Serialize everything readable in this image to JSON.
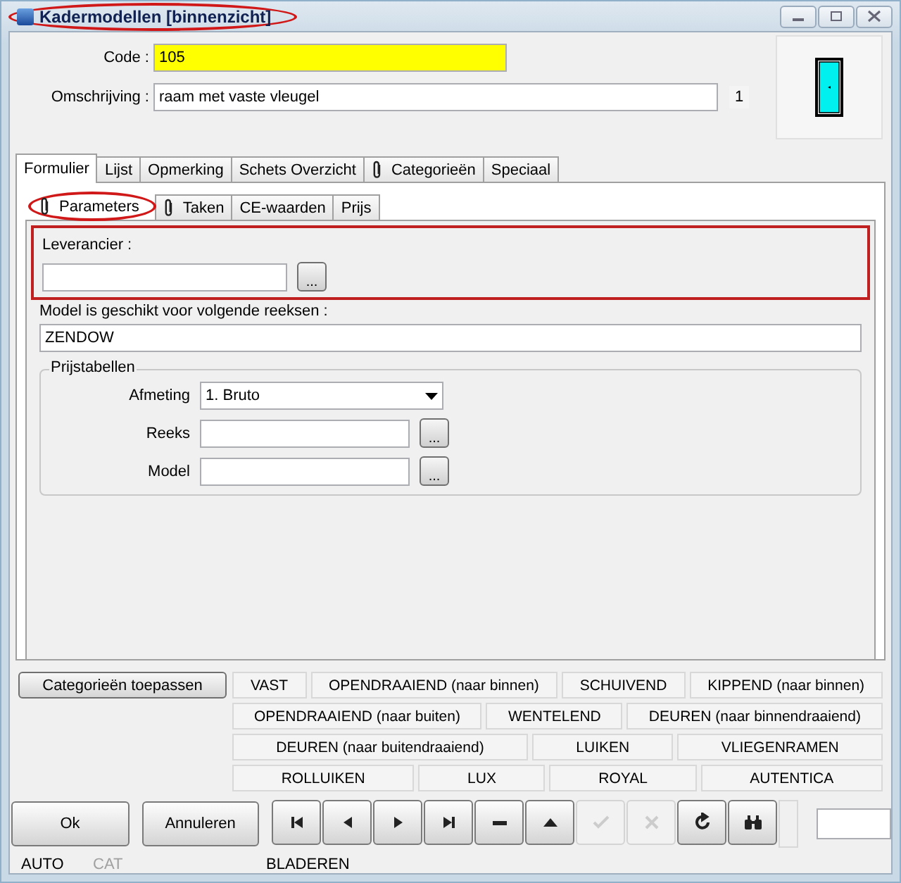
{
  "window": {
    "title": "Kadermodellen [binnenzicht]",
    "highlighted": true
  },
  "header": {
    "code_label": "Code :",
    "code": "105",
    "description_label": "Omschrijving :",
    "description": "raam met vaste vleugel",
    "description_count": "1"
  },
  "tabs": [
    {
      "label": "Formulier",
      "selected": true,
      "attachment": false
    },
    {
      "label": "Lijst",
      "selected": false,
      "attachment": false
    },
    {
      "label": "Opmerking",
      "selected": false,
      "attachment": false
    },
    {
      "label": "Schets Overzicht",
      "selected": false,
      "attachment": false
    },
    {
      "label": "Categorieën",
      "selected": false,
      "attachment": true
    },
    {
      "label": "Speciaal",
      "selected": false,
      "attachment": false
    }
  ],
  "subtabs": [
    {
      "label": "Parameters",
      "selected": true,
      "attachment": true,
      "highlighted": true
    },
    {
      "label": "Taken",
      "selected": false,
      "attachment": true,
      "highlighted": false
    },
    {
      "label": "CE-waarden",
      "selected": false,
      "attachment": false,
      "highlighted": false
    },
    {
      "label": "Prijs",
      "selected": false,
      "attachment": false,
      "highlighted": false
    }
  ],
  "supplier": {
    "label": "Leverancier :",
    "browse": "...",
    "highlighted": true
  },
  "series": {
    "label": "Model is geschikt voor volgende reeksen :",
    "value": "ZENDOW"
  },
  "price_tables": {
    "title": "Prijstabellen",
    "rows": [
      {
        "kind": "dropdown",
        "label": "Afmeting",
        "value": "1.  Bruto"
      },
      {
        "kind": "lookup",
        "label": "Reeks",
        "browse": "..."
      },
      {
        "kind": "lookup",
        "label": "Model",
        "browse": "..."
      }
    ]
  },
  "apply_button": "Categorieën toepassen",
  "category_rows": [
    [
      "VAST",
      "OPENDRAAIEND (naar binnen)",
      "SCHUIVEND",
      "KIPPEND (naar binnen)"
    ],
    [
      "OPENDRAAIEND (naar buiten)",
      "WENTELEND",
      "DEUREN (naar binnendraaiend)"
    ],
    [
      "DEUREN (naar buitendraaiend)",
      "LUIKEN",
      "VLIEGENRAMEN"
    ],
    [
      "ROLLUIKEN",
      "LUX",
      "ROYAL",
      "AUTENTICA"
    ]
  ],
  "footer": {
    "ok": "Ok",
    "cancel": "Annuleren",
    "tools": [
      {
        "kind": "first",
        "disabled": false
      },
      {
        "kind": "previous",
        "disabled": false
      },
      {
        "kind": "next",
        "disabled": false
      },
      {
        "kind": "last",
        "disabled": false
      },
      {
        "kind": "delete",
        "disabled": false
      },
      {
        "kind": "up",
        "disabled": false
      },
      {
        "kind": "confirm",
        "disabled": true
      },
      {
        "kind": "cancel",
        "disabled": true
      },
      {
        "kind": "refresh",
        "disabled": false
      },
      {
        "kind": "search",
        "disabled": false
      }
    ]
  },
  "status": [
    {
      "label": "AUTO",
      "disabled": false
    },
    {
      "label": "CAT",
      "disabled": true
    },
    {
      "label": "BLADEREN",
      "disabled": false
    }
  ]
}
